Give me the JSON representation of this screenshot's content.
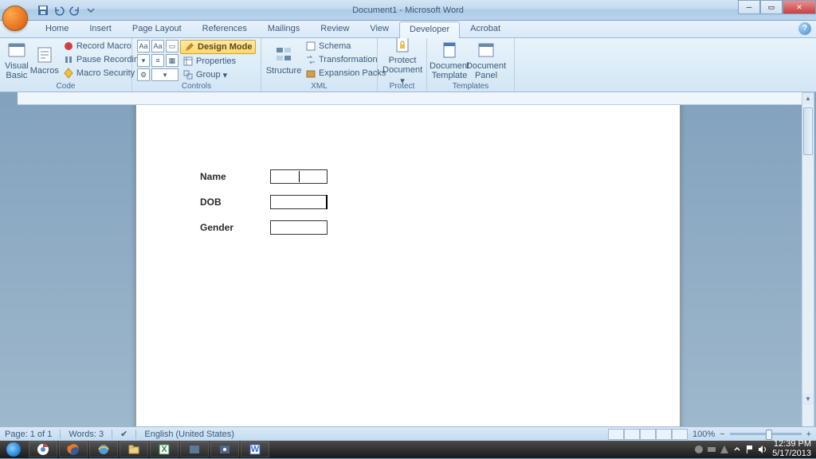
{
  "titlebar": {
    "title": "Document1 - Microsoft Word"
  },
  "tabs": {
    "items": [
      "Home",
      "Insert",
      "Page Layout",
      "References",
      "Mailings",
      "Review",
      "View",
      "Developer",
      "Acrobat"
    ],
    "active": "Developer"
  },
  "ribbon": {
    "code": {
      "label": "Code",
      "visual_basic": "Visual Basic",
      "macros": "Macros",
      "record_macro": "Record Macro",
      "pause_recording": "Pause Recording",
      "macro_security": "Macro Security"
    },
    "controls": {
      "label": "Controls",
      "design_mode": "Design Mode",
      "properties": "Properties",
      "group": "Group"
    },
    "xml": {
      "label": "XML",
      "structure": "Structure",
      "schema": "Schema",
      "transformation": "Transformation",
      "expansion_packs": "Expansion Packs"
    },
    "protect": {
      "label": "Protect",
      "protect_document": "Protect Document"
    },
    "templates": {
      "label": "Templates",
      "document_template": "Document Template",
      "document_panel": "Document Panel"
    }
  },
  "form": {
    "fields": [
      {
        "label": "Name"
      },
      {
        "label": "DOB"
      },
      {
        "label": "Gender"
      }
    ]
  },
  "statusbar": {
    "page": "Page: 1 of 1",
    "words": "Words: 3",
    "language": "English (United States)",
    "zoom": "100%"
  },
  "tray": {
    "time": "12:39 PM",
    "date": "5/17/2013"
  }
}
